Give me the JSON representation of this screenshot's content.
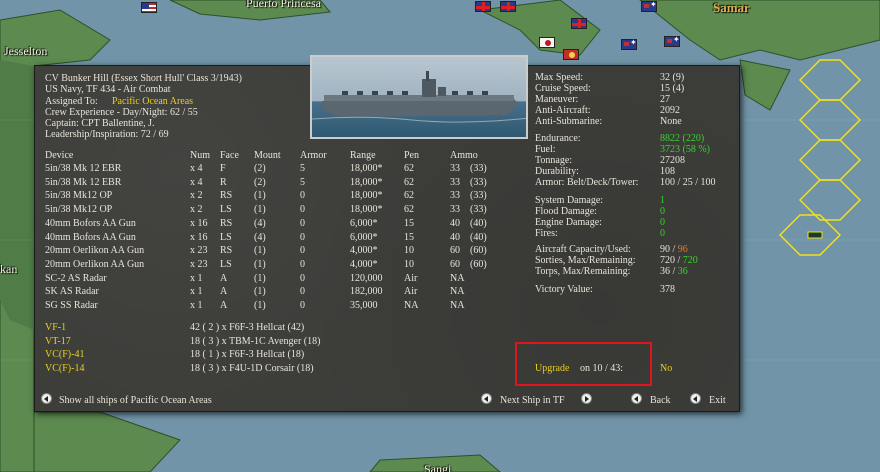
{
  "map": {
    "labels": [
      "Puerto Princesa",
      "Samar",
      "Jesselton",
      "kan",
      "Sangi"
    ]
  },
  "ship": {
    "title": "CV Bunker Hill (Essex Short Hull' Class 3/1943)",
    "navy": "US Navy, TF 434 - Air Combat",
    "assigned_label": "Assigned To:",
    "assigned_value": "Pacific Ocean Areas",
    "crew_exp": "Crew Experience - Day/Night: 62 / 55",
    "captain": "Captain:  CPT Ballentine, J.",
    "leadership": "Leadership/Inspiration: 72 / 69"
  },
  "devices": {
    "headers": [
      "Device",
      "Num",
      "Face",
      "Mount",
      "Armor",
      "Range",
      "Pen",
      "Ammo"
    ],
    "rows": [
      [
        "5in/38 Mk 12 EBR",
        "x 4",
        "F",
        "(2)",
        "5",
        "18,000*",
        "62",
        "33",
        "(33)"
      ],
      [
        "5in/38 Mk 12 EBR",
        "x 4",
        "R",
        "(2)",
        "5",
        "18,000*",
        "62",
        "33",
        "(33)"
      ],
      [
        "5in/38 Mk12 OP",
        "x 2",
        "RS",
        "(1)",
        "0",
        "18,000*",
        "62",
        "33",
        "(33)"
      ],
      [
        "5in/38 Mk12 OP",
        "x 2",
        "LS",
        "(1)",
        "0",
        "18,000*",
        "62",
        "33",
        "(33)"
      ],
      [
        "40mm Bofors AA Gun",
        "x 16",
        "RS",
        "(4)",
        "0",
        "6,000*",
        "15",
        "40",
        "(40)"
      ],
      [
        "40mm Bofors AA Gun",
        "x 16",
        "LS",
        "(4)",
        "0",
        "6,000*",
        "15",
        "40",
        "(40)"
      ],
      [
        "20mm Oerlikon AA Gun",
        "x 23",
        "RS",
        "(1)",
        "0",
        "4,000*",
        "10",
        "60",
        "(60)"
      ],
      [
        "20mm Oerlikon AA Gun",
        "x 23",
        "LS",
        "(1)",
        "0",
        "4,000*",
        "10",
        "60",
        "(60)"
      ],
      [
        "SC-2 AS Radar",
        "x 1",
        "A",
        "(1)",
        "0",
        "120,000",
        "Air",
        "NA",
        ""
      ],
      [
        "SK AS Radar",
        "x 1",
        "A",
        "(1)",
        "0",
        "182,000",
        "Air",
        "NA",
        ""
      ],
      [
        "SG SS Radar",
        "x 1",
        "A",
        "(1)",
        "0",
        "35,000",
        "NA",
        "NA",
        ""
      ]
    ]
  },
  "air_groups": [
    {
      "name": "VF-1",
      "desc": "42 ( 2 ) x F6F-3 Hellcat (42)"
    },
    {
      "name": "VT-17",
      "desc": "18 ( 3 ) x TBM-1C Avenger (18)"
    },
    {
      "name": "VC(F)-41",
      "desc": "18 ( 1 ) x F6F-3 Hellcat (18)"
    },
    {
      "name": "VC(F)-14",
      "desc": "18 ( 3 ) x F4U-1D Corsair (18)"
    }
  ],
  "stats": {
    "speed": [
      {
        "label": "Max Speed:",
        "value": "32 (9)"
      },
      {
        "label": "Cruise Speed:",
        "value": "15 (4)"
      },
      {
        "label": "Maneuver:",
        "value": "27"
      },
      {
        "label": "Anti-Aircraft:",
        "value": "2092"
      },
      {
        "label": "Anti-Submarine:",
        "value": "None"
      }
    ],
    "endurance": {
      "label": "Endurance:",
      "value": "8822 (220)"
    },
    "fuel": {
      "label": "Fuel:",
      "value": "3723 (58 %)"
    },
    "tonnage": {
      "label": "Tonnage:",
      "value": "27208"
    },
    "durability": {
      "label": "Durability:",
      "value": "108"
    },
    "armor": {
      "label": "Armor: Belt/Deck/Tower:",
      "value": "100 / 25 / 100"
    },
    "damage": [
      {
        "label": "System Damage:",
        "value": "1"
      },
      {
        "label": "Flood Damage:",
        "value": "0"
      },
      {
        "label": "Engine Damage:",
        "value": "0"
      },
      {
        "label": "Fires:",
        "value": "0"
      }
    ],
    "aircraft_capacity": {
      "label": "Aircraft Capacity/Used:",
      "value_a": "90 /",
      "value_b": "96"
    },
    "sorties": {
      "label": "Sorties, Max/Remaining:",
      "value_a": "720 /",
      "value_b": "720"
    },
    "torps": {
      "label": "Torps, Max/Remaining:",
      "value_a": "36 /",
      "value_b": "36"
    },
    "victory": {
      "label": "Victory Value:",
      "value": "378"
    }
  },
  "upgrade": {
    "label": "Upgrade",
    "on_text": "on 10 / 43:",
    "value": "No"
  },
  "footer": {
    "show_all": "Show all ships of Pacific Ocean Areas",
    "next_ship": "Next Ship in TF",
    "back": "Back",
    "exit": "Exit"
  },
  "colors": {
    "highlight": "#e0141c",
    "hex_grid": "#f0e020",
    "sea": "#6f8fa0",
    "land": "#5b8a4e"
  }
}
